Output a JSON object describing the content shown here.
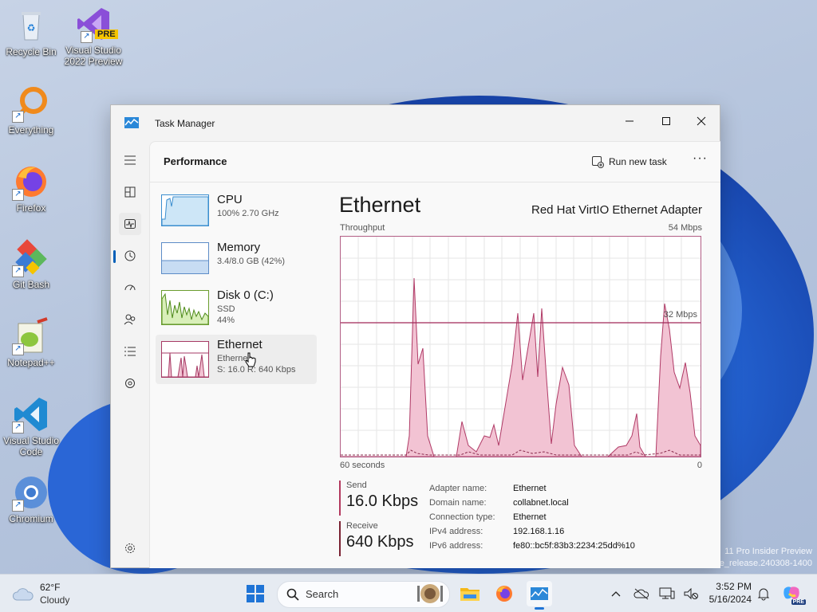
{
  "desktop": {
    "icons": [
      {
        "label": "Recycle Bin"
      },
      {
        "label": "Visual Studio 2022 Preview",
        "badge": "PRE"
      },
      {
        "label": "Everything"
      },
      {
        "label": "Firefox"
      },
      {
        "label": "Git Bash"
      },
      {
        "label": "Notepad++"
      },
      {
        "label": "Visual Studio Code"
      },
      {
        "label": "Chromium"
      }
    ],
    "watermark": [
      "11 Pro Insider Preview",
      "e_release.240308-1400"
    ]
  },
  "window": {
    "title": "Task Manager",
    "icon": "task-manager-icon",
    "controls": {
      "minimize": "minimize-icon",
      "maximize": "maximize-icon",
      "close": "close-icon"
    }
  },
  "nav": {
    "items": [
      {
        "icon": "hamburger-menu-icon"
      },
      {
        "icon": "processes-icon"
      },
      {
        "icon": "performance-icon",
        "selected": true
      },
      {
        "icon": "app-history-icon"
      },
      {
        "icon": "startup-apps-icon"
      },
      {
        "icon": "users-icon"
      },
      {
        "icon": "details-icon"
      },
      {
        "icon": "services-icon"
      }
    ],
    "settings_icon": "settings-icon"
  },
  "header": {
    "title": "Performance",
    "run_new_task": "Run new task",
    "more": "···"
  },
  "resources": [
    {
      "name": "CPU",
      "sub1": "100%  2.70 GHz",
      "sub2": ""
    },
    {
      "name": "Memory",
      "sub1": "3.4/8.0 GB (42%)",
      "sub2": ""
    },
    {
      "name": "Disk 0 (C:)",
      "sub1": "SSD",
      "sub2": "44%"
    },
    {
      "name": "Ethernet",
      "sub1": "Ethernet",
      "sub2": "S: 16.0  R: 640 Kbps",
      "selected": true
    }
  ],
  "detail": {
    "title": "Ethernet",
    "adapter": "Red Hat VirtIO Ethernet Adapter",
    "throughput_label": "Throughput",
    "max_label": "54 Mbps",
    "mid_label": "32 Mbps",
    "time_left": "60 seconds",
    "time_right": "0",
    "send_label": "Send",
    "send_value": "16.0 Kbps",
    "receive_label": "Receive",
    "receive_value": "640 Kbps",
    "properties": [
      {
        "key": "Adapter name:",
        "value": "Ethernet"
      },
      {
        "key": "Domain name:",
        "value": "collabnet.local"
      },
      {
        "key": "Connection type:",
        "value": "Ethernet"
      },
      {
        "key": "IPv4 address:",
        "value": "192.168.1.16"
      },
      {
        "key": "IPv6 address:",
        "value": "fe80::bc5f:83b3:2234:25dd%10"
      }
    ]
  },
  "taskbar": {
    "weather_temp": "62°F",
    "weather_desc": "Cloudy",
    "search_placeholder": "Search",
    "time": "3:52 PM",
    "date": "5/16/2024"
  }
}
